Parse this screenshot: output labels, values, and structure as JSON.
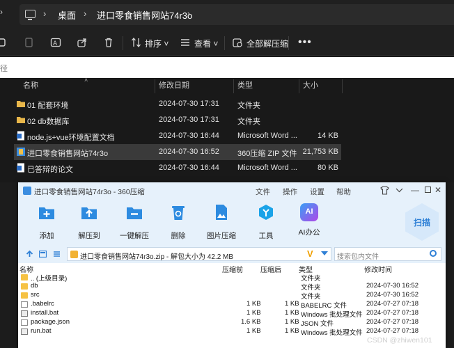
{
  "explorer": {
    "breadcrumb": [
      "桌面",
      "进口零食销售网站74r3o"
    ],
    "toolbar": {
      "sort_label": "排序",
      "view_label": "查看",
      "extract_all_label": "全部解压缩"
    },
    "search_stub": "径",
    "columns": {
      "name": "名称",
      "date": "修改日期",
      "type": "类型",
      "size": "大小"
    },
    "files": [
      {
        "name": "01 配套环境",
        "date": "2024-07-30 17:31",
        "type": "文件夹",
        "size": "",
        "icon": "folder-icon",
        "selected": false
      },
      {
        "name": "02 db数据库",
        "date": "2024-07-30 17:31",
        "type": "文件夹",
        "size": "",
        "icon": "folder-icon",
        "selected": false
      },
      {
        "name": "node.js+vue环境配置文档",
        "date": "2024-07-30 16:44",
        "type": "Microsoft Word ...",
        "size": "14 KB",
        "icon": "word-doc-icon",
        "selected": false
      },
      {
        "name": "进口零食销售网站74r3o",
        "date": "2024-07-30 16:52",
        "type": "360压缩 ZIP 文件",
        "size": "21,753 KB",
        "icon": "zip-archive-icon",
        "selected": true
      },
      {
        "name": "已答辩的论文",
        "date": "2024-07-30 16:44",
        "type": "Microsoft Word ...",
        "size": "80 KB",
        "icon": "word-doc-icon",
        "selected": false
      }
    ]
  },
  "zip_window": {
    "title": "进口零食销售网站74r3o - 360压缩",
    "menu": [
      "文件",
      "操作",
      "设置",
      "帮助"
    ],
    "tools": [
      {
        "label": "添加",
        "icon": "add-icon",
        "color": "#2d8be0"
      },
      {
        "label": "解压到",
        "icon": "extract-to-icon",
        "color": "#2d8be0"
      },
      {
        "label": "一键解压",
        "icon": "one-click-extract-icon",
        "color": "#2d8be0"
      },
      {
        "label": "删除",
        "icon": "delete-icon",
        "color": "#2d8be0"
      },
      {
        "label": "图片压缩",
        "icon": "image-compress-icon",
        "color": "#2d8be0"
      },
      {
        "label": "工具",
        "icon": "tools-icon",
        "color": "#1aa3e8"
      },
      {
        "label": "AI办公",
        "icon": "ai-office-icon",
        "color": "#8a55e0"
      }
    ],
    "scan_label": "扫描",
    "ai_badge": "AI",
    "path_text": "进口零食销售网站74r3o.zip - 解包大小为 42.2 MB",
    "search_placeholder": "搜索包内文件",
    "columns": {
      "name": "名称",
      "compressed": "压缩前",
      "uncompressed": "压缩后",
      "type": "类型",
      "modified": "修改时间"
    },
    "files": [
      {
        "name": ".. (上级目录)",
        "before": "",
        "after": "",
        "type": "文件夹",
        "date": "",
        "icon": "folder-icon"
      },
      {
        "name": "db",
        "before": "",
        "after": "",
        "type": "文件夹",
        "date": "2024-07-30 16:52",
        "icon": "folder-icon"
      },
      {
        "name": "src",
        "before": "",
        "after": "",
        "type": "文件夹",
        "date": "2024-07-30 16:52",
        "icon": "folder-icon"
      },
      {
        "name": ".babelrc",
        "before": "1 KB",
        "after": "1 KB",
        "type": "BABELRC 文件",
        "date": "2024-07-27 07:18",
        "icon": "file-icon"
      },
      {
        "name": "install.bat",
        "before": "1 KB",
        "after": "1 KB",
        "type": "Windows 批处理文件",
        "date": "2024-07-27 07:18",
        "icon": "batch-file-icon"
      },
      {
        "name": "package.json",
        "before": "1.6 KB",
        "after": "1 KB",
        "type": "JSON 文件",
        "date": "2024-07-27 07:18",
        "icon": "file-icon"
      },
      {
        "name": "run.bat",
        "before": "1 KB",
        "after": "1 KB",
        "type": "Windows 批处理文件",
        "date": "2024-07-27 07:18",
        "icon": "batch-file-icon"
      }
    ]
  },
  "watermark": "CSDN @zhiwen101"
}
